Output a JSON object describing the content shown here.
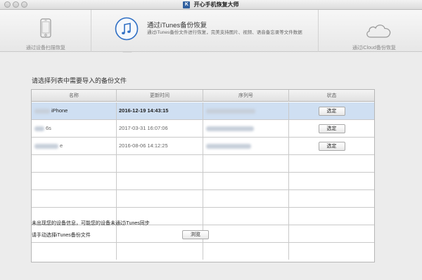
{
  "window": {
    "logo_text": "K",
    "title": "开心手机恢复大师"
  },
  "modes": {
    "device": {
      "label": "通过设备扫描恢复",
      "icon": "phone-icon"
    },
    "itunes": {
      "title": "通过iTunes备份恢复",
      "description": "通过iTunes备份文件进行恢复，完美支持图片、视频、语音备忘录等文件数据",
      "icon": "music-note-icon"
    },
    "icloud": {
      "label": "通过iCloud备份恢复",
      "icon": "cloud-icon"
    }
  },
  "main": {
    "section_title": "请选择列表中需要导入的备份文件",
    "table": {
      "columns": [
        "名称",
        "更新时间",
        "序列号",
        "状态"
      ],
      "rows": [
        {
          "name": "iPhone",
          "time": "2016-12-19 14:43:15",
          "serial": "",
          "action": "选定"
        },
        {
          "name": "6s",
          "time": "2017-03-31 16:07:06",
          "serial": "",
          "action": "选定"
        },
        {
          "name": "e",
          "time": "2016-08-06 14:12:25",
          "serial": "",
          "action": "选定"
        }
      ]
    },
    "note": "未出现您的设备信息，可能您的设备未通过iTunes同步",
    "manual_select_label": "请手动选择iTunes备份文件",
    "browse_label": "浏览"
  }
}
